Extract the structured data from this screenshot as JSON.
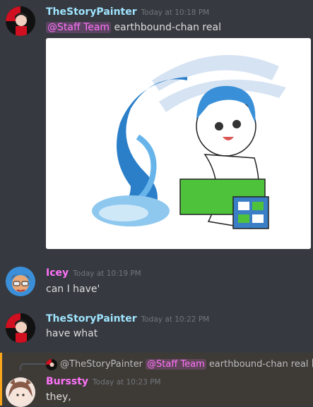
{
  "messages": [
    {
      "author": "TheStoryPainter",
      "timestamp": "Today at 10:18 PM",
      "mention": "@Staff Team",
      "text": "earthbound-chan real",
      "author_color": "#9fe4ff"
    },
    {
      "author": "Icey",
      "timestamp": "Today at 10:19 PM",
      "text": "can I have'",
      "author_color": "#ff73fa"
    },
    {
      "author": "TheStoryPainter",
      "timestamp": "Today at 10:22 PM",
      "text": "have what",
      "author_color": "#9fe4ff"
    },
    {
      "author": "Burssty",
      "timestamp": "Today at 10:23 PM",
      "text": "they,",
      "author_color": "#ff73fa"
    }
  ],
  "reply": {
    "author": "@TheStoryPainter",
    "mention": "@Staff Team",
    "text": "earthbound-chan real",
    "icon": "image-icon"
  },
  "colors": {
    "background": "#36393f",
    "highlight_border": "#faa61a",
    "mention": "#ff73fa"
  }
}
